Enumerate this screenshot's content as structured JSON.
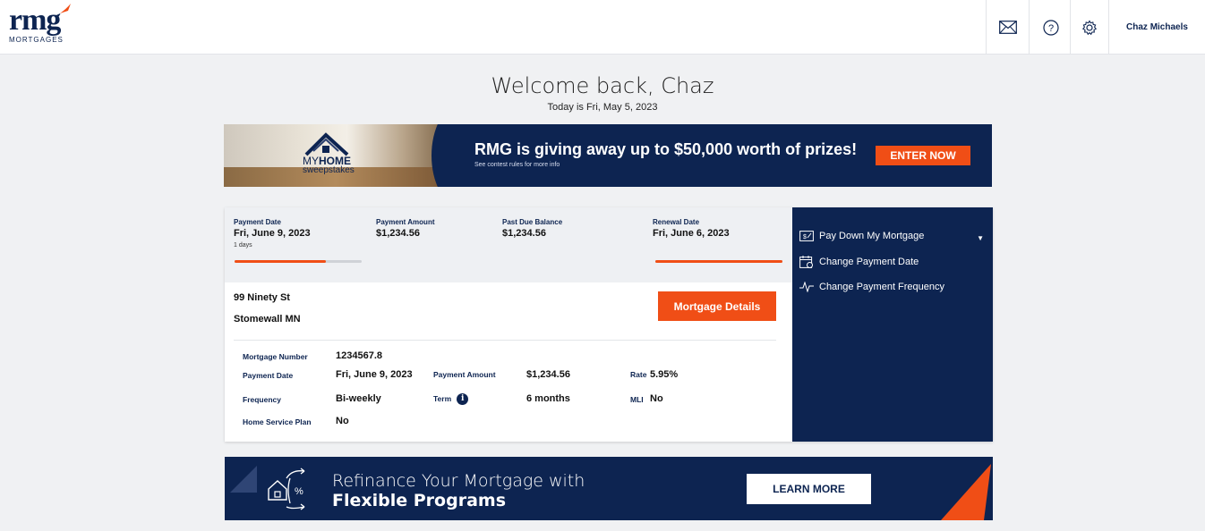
{
  "header": {
    "logo_text": "rmg",
    "logo_sub": "MORTGAGES",
    "icons": [
      "mail-icon",
      "help-icon",
      "gear-icon"
    ],
    "user_name": "Chaz Michaels"
  },
  "welcome": {
    "title": "Welcome back, Chaz",
    "today": "Today is Fri, May 5, 2023"
  },
  "promo": {
    "logo_line1": "MY",
    "logo_line2": "HOME",
    "logo_line3": "sweepstakes",
    "title": "RMG is giving away up to $50,000 worth of prizes!",
    "subtitle": "See contest rules for more info",
    "button": "ENTER NOW"
  },
  "summary": {
    "payment_date_label": "Payment Date",
    "payment_date": "Fri, June 9, 2023",
    "payment_days": "1 days",
    "payment_progress": 0.72,
    "payment_amount_label": "Payment Amount",
    "payment_amount": "$1,234.56",
    "past_due_label": "Past Due Balance",
    "past_due": "$1,234.56",
    "renewal_label": "Renewal Date",
    "renewal_date": "Fri, June 6, 2023",
    "renewal_progress": 1.0
  },
  "address": {
    "line1": "99 Ninety St",
    "line2": "Stomewall MN",
    "details_button": "Mortgage Details"
  },
  "details": {
    "mortgage_number_label": "Mortgage Number",
    "mortgage_number": "1234567.8",
    "payment_date_label": "Payment Date",
    "payment_date": "Fri, June 9, 2023",
    "payment_amount_label": "Payment Amount",
    "payment_amount": "$1,234.56",
    "rate_label": "Rate",
    "rate": "5.95%",
    "frequency_label": "Frequency",
    "frequency": "Bi-weekly",
    "term_label": "Term",
    "term": "6 months",
    "mli_label": "MLI",
    "mli": "No",
    "home_service_label": "Home Service Plan",
    "home_service": "No"
  },
  "side_menu": {
    "items": [
      {
        "label": "Pay Down My Mortgage",
        "icon": "cheque-icon"
      },
      {
        "label": "Change Payment Date",
        "icon": "calendar-icon"
      },
      {
        "label": "Change Payment Frequency",
        "icon": "pulse-icon"
      }
    ]
  },
  "refinance": {
    "title_line1": "Refinance Your Mortgage with",
    "title_line2": "Flexible Programs",
    "button": "LEARN MORE"
  },
  "colors": {
    "navy": "#0d2451",
    "orange": "#f04e16",
    "background": "#f0f1f3"
  }
}
